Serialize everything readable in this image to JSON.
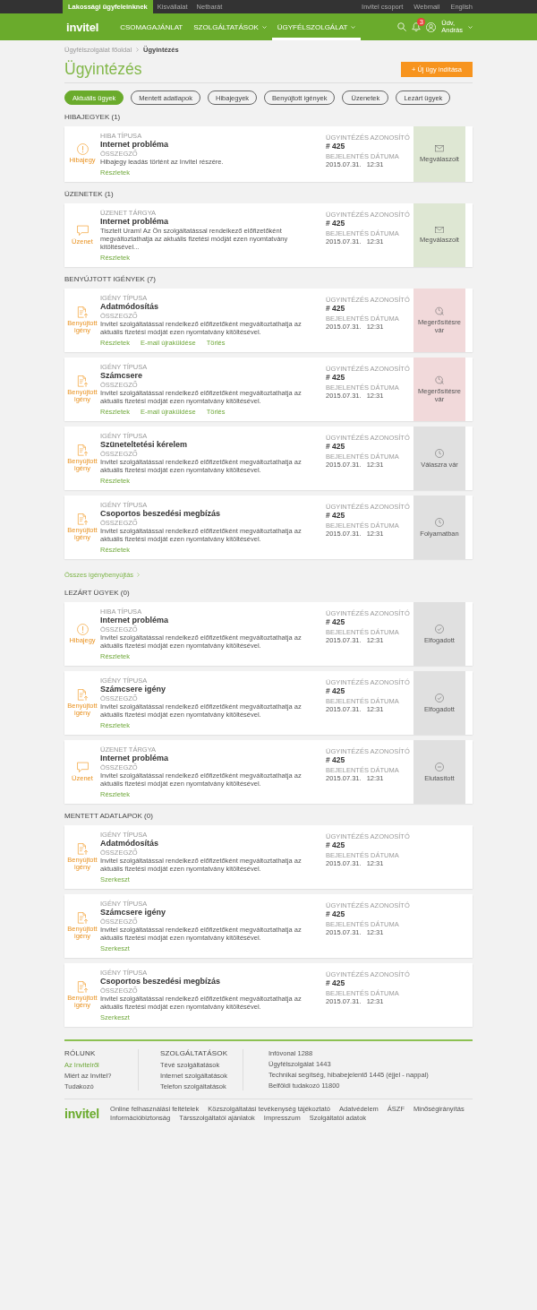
{
  "top_bar": {
    "segments": [
      {
        "label": "Lakossági ügyfeleinknek",
        "selected": true
      },
      {
        "label": "Kisvállalat",
        "selected": false
      },
      {
        "label": "Netbarát",
        "selected": false
      }
    ],
    "links": [
      "Invitel csoport",
      "Webmail",
      "English"
    ]
  },
  "nav": {
    "logo": "invitel",
    "items": [
      {
        "label": "CSOMAGAJÁNLAT",
        "selected": false,
        "dropdown": false
      },
      {
        "label": "SZOLGÁLTATÁSOK",
        "selected": false,
        "dropdown": true
      },
      {
        "label": "ÜGYFÉLSZOLGÁLAT",
        "selected": true,
        "dropdown": true
      }
    ],
    "notification_count": "3",
    "user": {
      "greeting": "Üdv,",
      "name": "András"
    }
  },
  "breadcrumb": [
    {
      "label": "Ügyfélszolgálat főoldal",
      "selected": false
    },
    {
      "label": "Ügyintézés",
      "selected": true
    }
  ],
  "page_title": "Ügyintézés",
  "new_case_button": "+ Új ügy indítása",
  "filter_tabs": [
    {
      "label": "Aktuális ügyek",
      "selected": true
    },
    {
      "label": "Mentett adatlapok",
      "selected": false
    },
    {
      "label": "Hibajegyek",
      "selected": false
    },
    {
      "label": "Benyújtott igények",
      "selected": false
    },
    {
      "label": "Üzenetek",
      "selected": false
    },
    {
      "label": "Lezárt ügyek",
      "selected": false
    }
  ],
  "sections": [
    {
      "heading": "HIBAJEGYEK (1)",
      "cards": [
        {
          "kind": "ticket",
          "category": "Hibajegy",
          "type_label": "HIBA TÍPUSA",
          "title": "Internet probléma",
          "summary_label": "ÖSSZEGZŐ",
          "summary": "Hibajegy leadás történt az Invitel részére.",
          "links": [
            "Részletek"
          ],
          "id_label": "ÜGYINTÉZÉS AZONOSÍTÓ",
          "id": "# 425",
          "date_label": "BEJELENTÉS DÁTUMA",
          "date": "2015.07.31.",
          "time": "12:31",
          "status": {
            "kind": "answered",
            "label": "Megválaszolt",
            "color": "#dee7d3"
          }
        }
      ]
    },
    {
      "heading": "ÜZENETEK (1)",
      "cards": [
        {
          "kind": "message",
          "category": "Üzenet",
          "type_label": "ÜZENET TÁRGYA",
          "title": "Internet probléma",
          "summary": "Tisztelt Uram! Az Ön szolgáltatással rendelkező előfizetőként megváltoztathatja az aktuális fizetési módját ezen nyomtatvány kitöltésével...",
          "links": [
            "Részletek"
          ],
          "id_label": "ÜGYINTÉZÉS AZONOSÍTÓ",
          "id": "# 425",
          "date_label": "BEJELENTÉS DÁTUMA",
          "date": "2015.07.31.",
          "time": "12:31",
          "status": {
            "kind": "answered",
            "label": "Megválaszolt",
            "color": "#dee7d3"
          }
        }
      ]
    },
    {
      "heading": "BENYÚJTOTT IGÉNYEK (7)",
      "cards": [
        {
          "kind": "request",
          "category": "Benyújtott igény",
          "type_label": "IGÉNY TÍPUSA",
          "title": "Adatmódosítás",
          "summary_label": "ÖSSZEGZŐ",
          "summary": "Invitel szolgáltatással rendelkező előfizetőként megváltoztathatja az aktuális fizetési módját ezen nyomtatvány kitöltésével.",
          "links": [
            "Részletek",
            "E-mail újraküldése",
            "Törlés"
          ],
          "id_label": "ÜGYINTÉZÉS AZONOSÍTÓ",
          "id": "# 425",
          "date_label": "BEJELENTÉS DÁTUMA",
          "date": "2015.07.31.",
          "time": "12:31",
          "status": {
            "kind": "pending_confirmation",
            "label": "Megerősítésre vár",
            "color": "#f1d9da"
          }
        },
        {
          "kind": "request",
          "category": "Benyújtott igény",
          "type_label": "IGÉNY TÍPUSA",
          "title": "Számcsere",
          "summary_label": "ÖSSZEGZŐ",
          "summary": "Invitel szolgáltatással rendelkező előfizetőként megváltoztathatja az aktuális fizetési módját ezen nyomtatvány kitöltésével.",
          "links": [
            "Részletek",
            "E-mail újraküldése",
            "Törlés"
          ],
          "id_label": "ÜGYINTÉZÉS AZONOSÍTÓ",
          "id": "# 425",
          "date_label": "BEJELENTÉS DÁTUMA",
          "date": "2015.07.31.",
          "time": "12:31",
          "status": {
            "kind": "pending_confirmation",
            "label": "Megerősítésre vár",
            "color": "#f1d9da"
          }
        },
        {
          "kind": "request",
          "category": "Benyújtott igény",
          "type_label": "IGÉNY TÍPUSA",
          "title": "Szüneteltetési kérelem",
          "summary_label": "ÖSSZEGZŐ",
          "summary": "Invitel szolgáltatással rendelkező előfizetőként megváltoztathatja az aktuális fizetési módját ezen nyomtatvány kitöltésével.",
          "links": [
            "Részletek"
          ],
          "id_label": "ÜGYINTÉZÉS AZONOSÍTÓ",
          "id": "# 425",
          "date_label": "BEJELENTÉS DÁTUMA",
          "date": "2015.07.31.",
          "time": "12:31",
          "status": {
            "kind": "waiting",
            "label": "Válaszra vár",
            "color": "#e0e0e0"
          }
        },
        {
          "kind": "request",
          "category": "Benyújtott igény",
          "type_label": "IGÉNY TÍPUSA",
          "title": "Csoportos beszedési megbízás",
          "summary_label": "ÖSSZEGZŐ",
          "summary": "Invitel szolgáltatással rendelkező előfizetőként megváltoztathatja az aktuális fizetési módját ezen nyomtatvány kitöltésével.",
          "links": [
            "Részletek"
          ],
          "id_label": "ÜGYINTÉZÉS AZONOSÍTÓ",
          "id": "# 425",
          "date_label": "BEJELENTÉS DÁTUMA",
          "date": "2015.07.31.",
          "time": "12:31",
          "status": {
            "kind": "waiting",
            "label": "Folyamatban",
            "color": "#e0e0e0"
          }
        }
      ],
      "footer_link": "Összes igénybenyújtás"
    },
    {
      "heading": "LEZÁRT ÜGYEK (0)",
      "cards": [
        {
          "kind": "ticket",
          "category": "Hibajegy",
          "type_label": "HIBA TÍPUSA",
          "title": "Internet probléma",
          "summary_label": "ÖSSZEGZŐ",
          "summary": "Invitel szolgáltatással rendelkező előfizetőként megváltoztathatja az aktuális fizetési módját ezen nyomtatvány kitöltésével.",
          "links": [
            "Részletek"
          ],
          "id_label": "ÜGYINTÉZÉS AZONOSÍTÓ",
          "id": "# 425",
          "date_label": "BEJELENTÉS DÁTUMA",
          "date": "2015.07.31.",
          "time": "12:31",
          "status": {
            "kind": "accepted",
            "label": "Elfogadott",
            "color": "#e0e0e0"
          }
        },
        {
          "kind": "request",
          "category": "Benyújtott igény",
          "type_label": "IGÉNY TÍPUSA",
          "title": "Számcsere igény",
          "summary_label": "ÖSSZEGZŐ",
          "summary": "Invitel szolgáltatással rendelkező előfizetőként megváltoztathatja az aktuális fizetési módját ezen nyomtatvány kitöltésével.",
          "links": [
            "Részletek"
          ],
          "id_label": "ÜGYINTÉZÉS AZONOSÍTÓ",
          "id": "# 425",
          "date_label": "BEJELENTÉS DÁTUMA",
          "date": "2015.07.31.",
          "time": "12:31",
          "status": {
            "kind": "accepted",
            "label": "Elfogadott",
            "color": "#e0e0e0"
          }
        },
        {
          "kind": "message",
          "category": "Üzenet",
          "type_label": "ÜZENET TÁRGYA",
          "title": "Internet probléma",
          "summary_label": "ÖSSZEGZŐ",
          "summary": "Invitel szolgáltatással rendelkező előfizetőként megváltoztathatja az aktuális fizetési módját ezen nyomtatvány kitöltésével.",
          "links": [
            "Részletek"
          ],
          "id_label": "ÜGYINTÉZÉS AZONOSÍTÓ",
          "id": "# 425",
          "date_label": "BEJELENTÉS DÁTUMA",
          "date": "2015.07.31.",
          "time": "12:31",
          "status": {
            "kind": "rejected",
            "label": "Elutasított",
            "color": "#e0e0e0"
          }
        }
      ]
    },
    {
      "heading": "MENTETT ADATLAPOK (0)",
      "cards": [
        {
          "kind": "request",
          "category": "Benyújtott igény",
          "type_label": "IGÉNY TÍPUSA",
          "title": "Adatmódosítás",
          "summary_label": "ÖSSZEGZŐ",
          "summary": "Invitel szolgáltatással rendelkező előfizetőként megváltoztathatja az aktuális fizetési módját ezen nyomtatvány kitöltésével.",
          "links": [
            "Szerkeszt"
          ],
          "id_label": "ÜGYINTÉZÉS AZONOSÍTÓ",
          "id": "# 425",
          "date_label": "BEJELENTÉS DÁTUMA",
          "date": "2015.07.31.",
          "time": "12:31"
        },
        {
          "kind": "request",
          "category": "Benyújtott igény",
          "type_label": "IGÉNY TÍPUSA",
          "title": "Számcsere igény",
          "summary_label": "ÖSSZEGZŐ",
          "summary": "Invitel szolgáltatással rendelkező előfizetőként megváltoztathatja az aktuális fizetési módját ezen nyomtatvány kitöltésével.",
          "links": [
            "Szerkeszt"
          ],
          "id_label": "ÜGYINTÉZÉS AZONOSÍTÓ",
          "id": "# 425",
          "date_label": "BEJELENTÉS DÁTUMA",
          "date": "2015.07.31.",
          "time": "12:31"
        },
        {
          "kind": "request",
          "category": "Benyújtott igény",
          "type_label": "IGÉNY TÍPUSA",
          "title": "Csoportos beszedési megbízás",
          "summary_label": "ÖSSZEGZŐ",
          "summary": "Invitel szolgáltatással rendelkező előfizetőként megváltoztathatja az aktuális fizetési módját ezen nyomtatvány kitöltésével.",
          "links": [
            "Szerkeszt"
          ],
          "id_label": "ÜGYINTÉZÉS AZONOSÍTÓ",
          "id": "# 425",
          "date_label": "BEJELENTÉS DÁTUMA",
          "date": "2015.07.31.",
          "time": "12:31"
        }
      ]
    }
  ],
  "footer": {
    "columns": [
      {
        "heading": "RÓLUNK",
        "links": [
          {
            "label": "Az Invitelről",
            "selected": true
          },
          {
            "label": "Miért az Invitel?",
            "selected": false
          },
          {
            "label": "Tudakozó",
            "selected": false
          }
        ]
      },
      {
        "heading": "SZOLGÁLTATÁSOK",
        "links": [
          {
            "label": "Tévé szolgáltatások",
            "selected": false
          },
          {
            "label": "Internet szolgáltatások",
            "selected": false
          },
          {
            "label": "Telefon szolgáltatások",
            "selected": false
          }
        ]
      }
    ],
    "contacts": [
      "Infóvonal 1288",
      "Ügyfélszolgálat 1443",
      "Technikai segítség, hibabejelentő  1445 (éjjel - nappal)",
      "Belföldi tudakozó 11800"
    ],
    "logo": "invitel",
    "legal_links": [
      "Online felhasználási feltételek",
      "Közszolgáltatási tevékenység tájékoztató",
      "Adatvédelem",
      "ÁSZF",
      "Minőségirányítás",
      "Információbiztonság",
      "Társszolgáltatói ajánlatok",
      "Impresszum",
      "Szolgáltatói adatok"
    ]
  }
}
